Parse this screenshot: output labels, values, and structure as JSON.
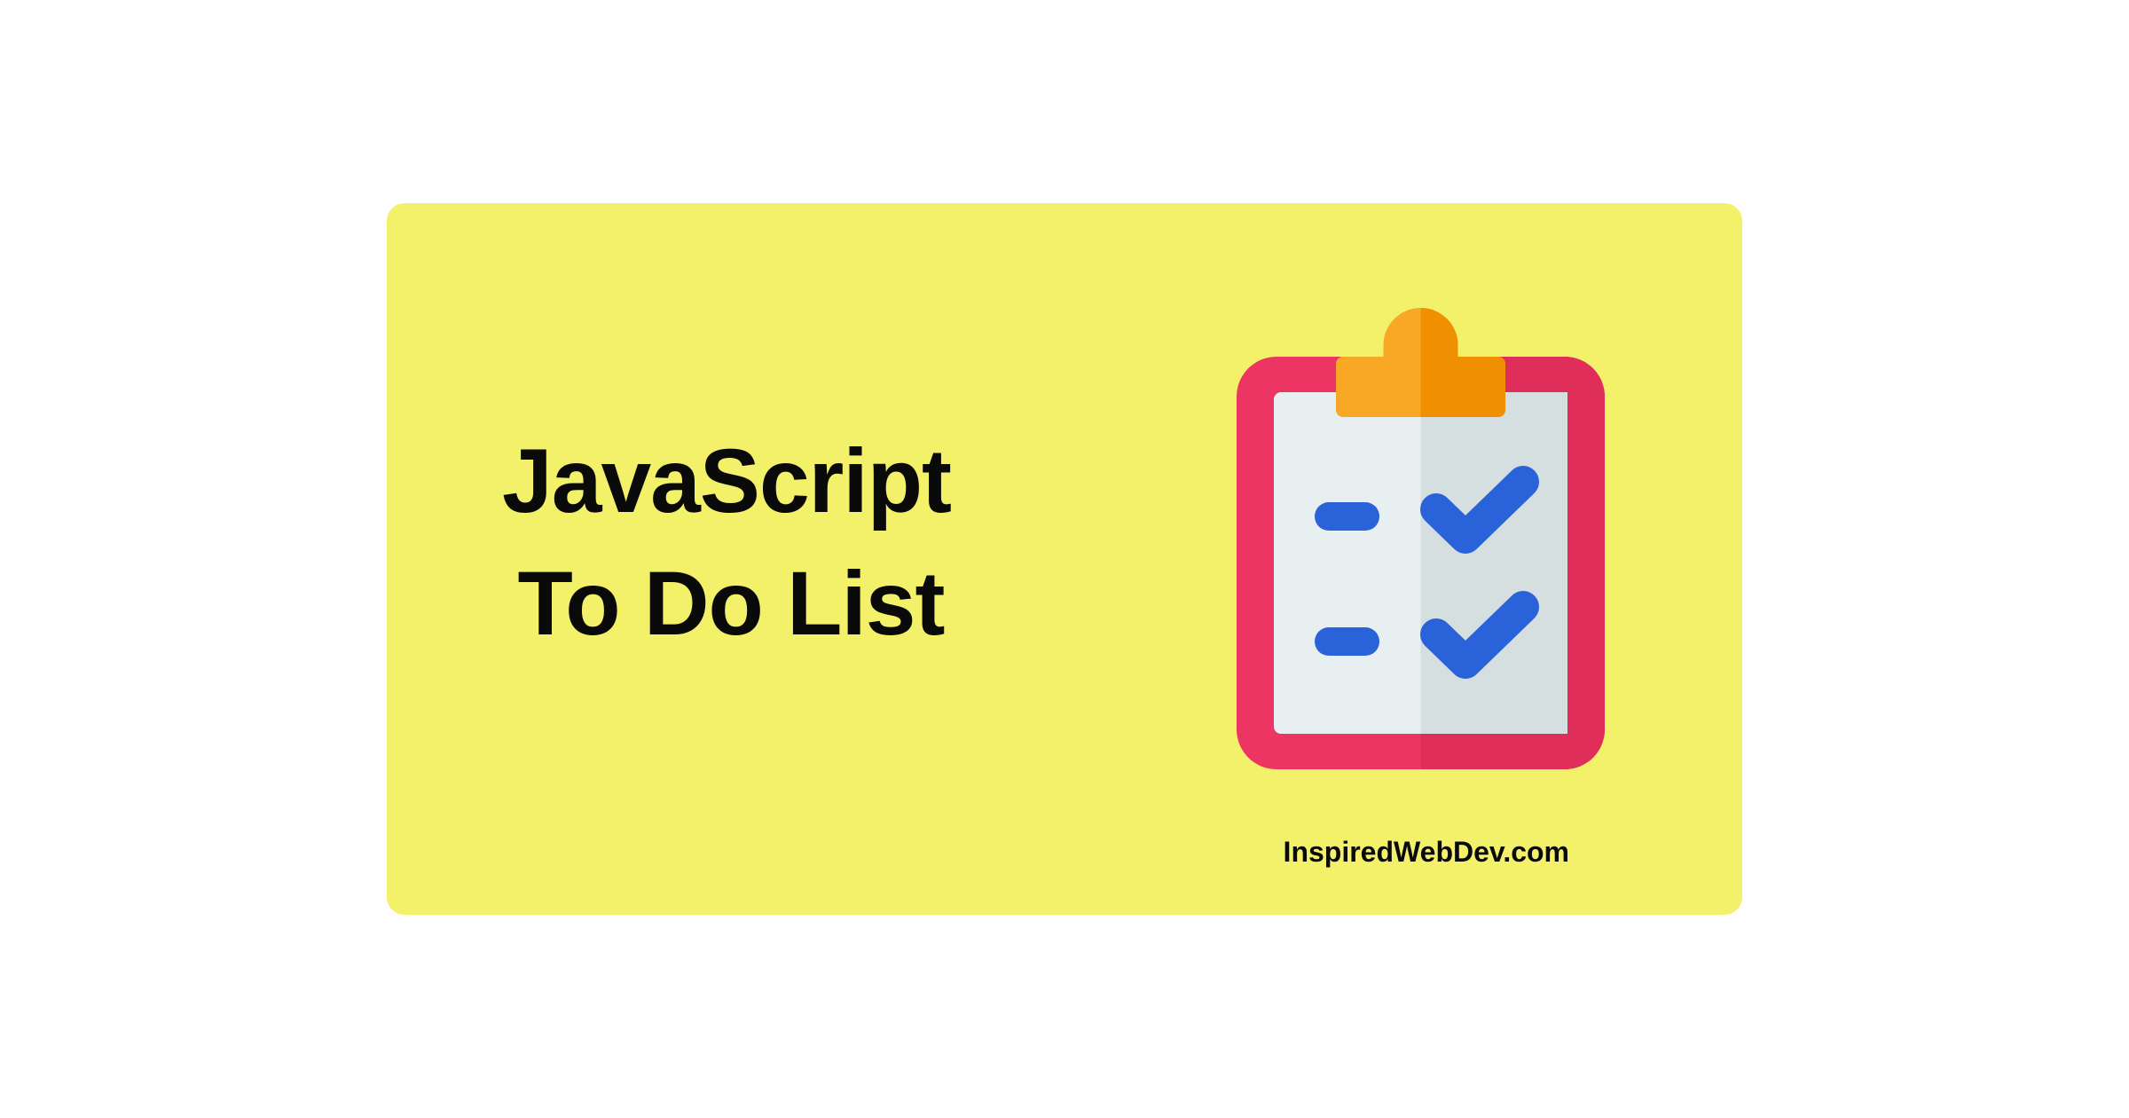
{
  "title_line1": "JavaScript",
  "title_line2": "To Do List",
  "attribution": "InspiredWebDev.com",
  "colors": {
    "background": "#f3f069",
    "text": "#0a0a0a",
    "clipboard_board": "#ed3563",
    "clipboard_board_dark": "#e02e5a",
    "clipboard_paper": "#e8eff0",
    "clipboard_paper_dark": "#d5dfe0",
    "clipboard_clip": "#f9a825",
    "clipboard_clip_dark": "#f09000",
    "checkmark": "#2962d9",
    "checkmark_dark": "#1e52c0"
  }
}
